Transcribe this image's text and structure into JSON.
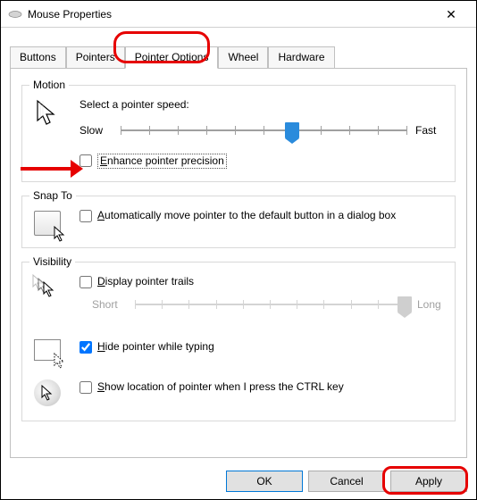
{
  "window": {
    "title": "Mouse Properties",
    "close_label": "Close"
  },
  "tabs": [
    {
      "label": "Buttons"
    },
    {
      "label": "Pointers"
    },
    {
      "label": "Pointer Options"
    },
    {
      "label": "Wheel"
    },
    {
      "label": "Hardware"
    }
  ],
  "active_tab_index": 2,
  "motion": {
    "legend": "Motion",
    "speed_label": "Select a pointer speed:",
    "slow": "Slow",
    "fast": "Fast",
    "speed_value": 6,
    "speed_ticks": 11,
    "enhance_checked": false,
    "enhance_label": "Enhance pointer precision",
    "enhance_access": "E"
  },
  "snap": {
    "legend": "Snap To",
    "auto_checked": false,
    "auto_label": "Automatically move pointer to the default button in a dialog box",
    "auto_access": "A"
  },
  "visibility": {
    "legend": "Visibility",
    "trails_checked": false,
    "trails_label": "Display pointer trails",
    "trails_access": "D",
    "trails_short": "Short",
    "trails_long": "Long",
    "trails_value": 10,
    "trails_ticks": 11,
    "trails_enabled": false,
    "hide_checked": true,
    "hide_label": "Hide pointer while typing",
    "hide_access": "H",
    "ctrl_checked": false,
    "ctrl_label": "Show location of pointer when I press the CTRL key",
    "ctrl_access": "S"
  },
  "buttons": {
    "ok": "OK",
    "cancel": "Cancel",
    "apply": "Apply"
  },
  "annotation": {
    "tab_highlight_tab_index": 2,
    "apply_highlighted": true,
    "arrow_target": "enhance-pointer-precision"
  }
}
